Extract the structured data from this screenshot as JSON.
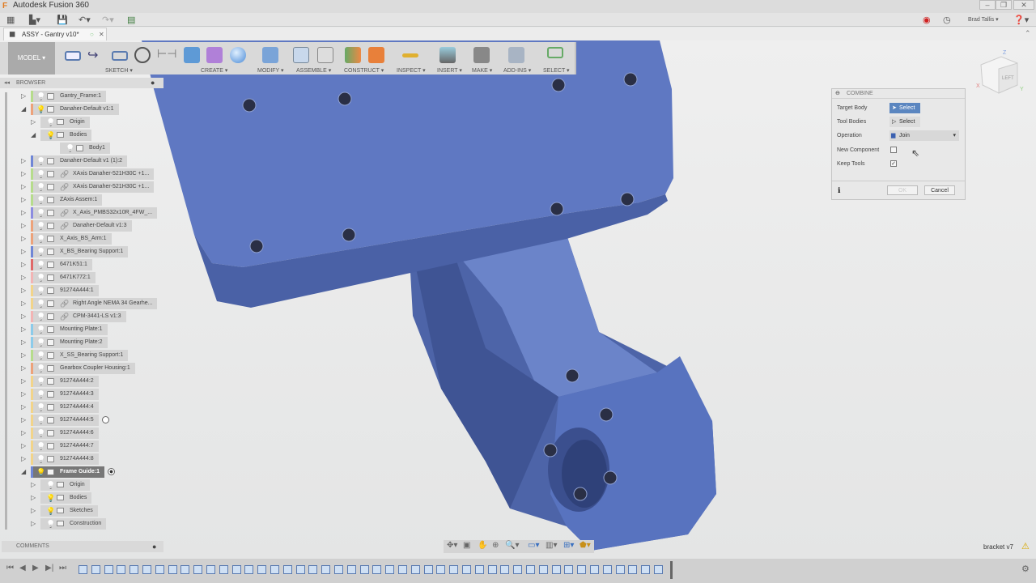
{
  "app": {
    "title": "Autodesk Fusion 360",
    "user": "Brad Tallis"
  },
  "document_tab": {
    "title": "ASSY - Gantry v10*"
  },
  "ribbon": {
    "workspace": "MODEL",
    "groups": [
      "SKETCH",
      "CREATE",
      "MODIFY",
      "ASSEMBLE",
      "CONSTRUCT",
      "INSPECT",
      "INSERT",
      "MAKE",
      "ADD-INS",
      "SELECT"
    ]
  },
  "browser": {
    "title": "BROWSER",
    "items": [
      {
        "label": "Gantry_Frame:1",
        "level": 0,
        "state": "collapsed",
        "color": "#b6dc8c",
        "type": "component"
      },
      {
        "label": "Danaher-Default v1:1",
        "level": 0,
        "state": "expanded",
        "color": "#eda27a",
        "type": "body",
        "bulb_on": true
      },
      {
        "label": "Origin",
        "level": 1,
        "state": "collapsed",
        "type": "folder"
      },
      {
        "label": "Bodies",
        "level": 1,
        "state": "expanded",
        "type": "folder",
        "bulb_on": true
      },
      {
        "label": "Body1",
        "level": 2,
        "state": "none",
        "type": "body"
      },
      {
        "label": "Danaher-Default v1 (1):2",
        "level": 0,
        "state": "collapsed",
        "color": "#6f86d6",
        "type": "body"
      },
      {
        "label": "XAxis Danaher-521H30C +1...",
        "level": 0,
        "state": "collapsed",
        "color": "#b6dc8c",
        "type": "component",
        "linked": true
      },
      {
        "label": "XAxis Danaher-521H30C +1...",
        "level": 0,
        "state": "collapsed",
        "color": "#b6dc8c",
        "type": "component",
        "linked": true
      },
      {
        "label": "ZAxis Assem:1",
        "level": 0,
        "state": "collapsed",
        "color": "#b6dc8c",
        "type": "component"
      },
      {
        "label": "X_Axis_PMBS32x10R_4FW_...",
        "level": 0,
        "state": "collapsed",
        "color": "#8c8ce0",
        "type": "component",
        "linked": true
      },
      {
        "label": "Danaher-Default v1:3",
        "level": 0,
        "state": "collapsed",
        "color": "#eda27a",
        "type": "body",
        "linked": true
      },
      {
        "label": "X_Axis_BS_Arm:1",
        "level": 0,
        "state": "collapsed",
        "color": "#eda27a",
        "type": "body"
      },
      {
        "label": "X_BS_Bearing Support:1",
        "level": 0,
        "state": "collapsed",
        "color": "#6f86d6",
        "type": "body"
      },
      {
        "label": "6471K51:1",
        "level": 0,
        "state": "collapsed",
        "color": "#e06868",
        "type": "body"
      },
      {
        "label": "6471K772:1",
        "level": 0,
        "state": "collapsed",
        "color": "#f2b4b4",
        "type": "component"
      },
      {
        "label": "91274A444:1",
        "level": 0,
        "state": "collapsed",
        "color": "#f2d48a",
        "type": "body"
      },
      {
        "label": "Right Angle NEMA 34 Gearhe...",
        "level": 0,
        "state": "collapsed",
        "color": "#f2d48a",
        "type": "component",
        "linked": true
      },
      {
        "label": "CPM-3441-LS v1:3",
        "level": 0,
        "state": "collapsed",
        "color": "#f2b4b4",
        "type": "body",
        "linked": true
      },
      {
        "label": "Mounting Plate:1",
        "level": 0,
        "state": "collapsed",
        "color": "#8ccbea",
        "type": "body"
      },
      {
        "label": "Mounting Plate:2",
        "level": 0,
        "state": "collapsed",
        "color": "#8ccbea",
        "type": "body"
      },
      {
        "label": "X_SS_Bearing Support:1",
        "level": 0,
        "state": "collapsed",
        "color": "#b6dc8c",
        "type": "body"
      },
      {
        "label": "Gearbox Coupler Housing:1",
        "level": 0,
        "state": "collapsed",
        "color": "#eda27a",
        "type": "body"
      },
      {
        "label": "91274A444:2",
        "level": 0,
        "state": "collapsed",
        "color": "#f2d48a",
        "type": "body"
      },
      {
        "label": "91274A444:3",
        "level": 0,
        "state": "collapsed",
        "color": "#f2d48a",
        "type": "body"
      },
      {
        "label": "91274A444:4",
        "level": 0,
        "state": "collapsed",
        "color": "#f2d48a",
        "type": "body"
      },
      {
        "label": "91274A444:5",
        "level": 0,
        "state": "collapsed",
        "color": "#f2d48a",
        "type": "body",
        "radio": "off"
      },
      {
        "label": "91274A444:6",
        "level": 0,
        "state": "collapsed",
        "color": "#f2d48a",
        "type": "body"
      },
      {
        "label": "91274A444:7",
        "level": 0,
        "state": "collapsed",
        "color": "#f2d48a",
        "type": "body"
      },
      {
        "label": "91274A444:8",
        "level": 0,
        "state": "collapsed",
        "color": "#f2d48a",
        "type": "body"
      },
      {
        "label": "Frame Guide:1",
        "level": 0,
        "state": "expanded",
        "color": "#6f86d6",
        "type": "body",
        "bulb_on": true,
        "active": true,
        "radio": "on"
      },
      {
        "label": "Origin",
        "level": 1,
        "state": "collapsed",
        "type": "folder"
      },
      {
        "label": "Bodies",
        "level": 1,
        "state": "collapsed",
        "type": "folder",
        "bulb_on": true
      },
      {
        "label": "Sketches",
        "level": 1,
        "state": "collapsed",
        "type": "folder",
        "bulb_on": true
      },
      {
        "label": "Construction",
        "level": 1,
        "state": "collapsed",
        "type": "folder"
      }
    ]
  },
  "comments": {
    "title": "COMMENTS"
  },
  "combine": {
    "title": "COMBINE",
    "target_body_label": "Target Body",
    "target_body_value": "Select",
    "tool_bodies_label": "Tool Bodies",
    "tool_bodies_value": "Select",
    "operation_label": "Operation",
    "operation_value": "Join",
    "new_component_label": "New Component",
    "new_component_checked": false,
    "keep_tools_label": "Keep Tools",
    "keep_tools_checked": true,
    "ok": "OK",
    "cancel": "Cancel"
  },
  "viewcube": {
    "face": "LEFT",
    "axes": [
      "X",
      "Y",
      "Z"
    ]
  },
  "status": {
    "document_name": "bracket v7"
  },
  "colors": {
    "model": "#5b74bd",
    "accent": "#5b86c0",
    "ribbon": "#d9d9d9"
  }
}
